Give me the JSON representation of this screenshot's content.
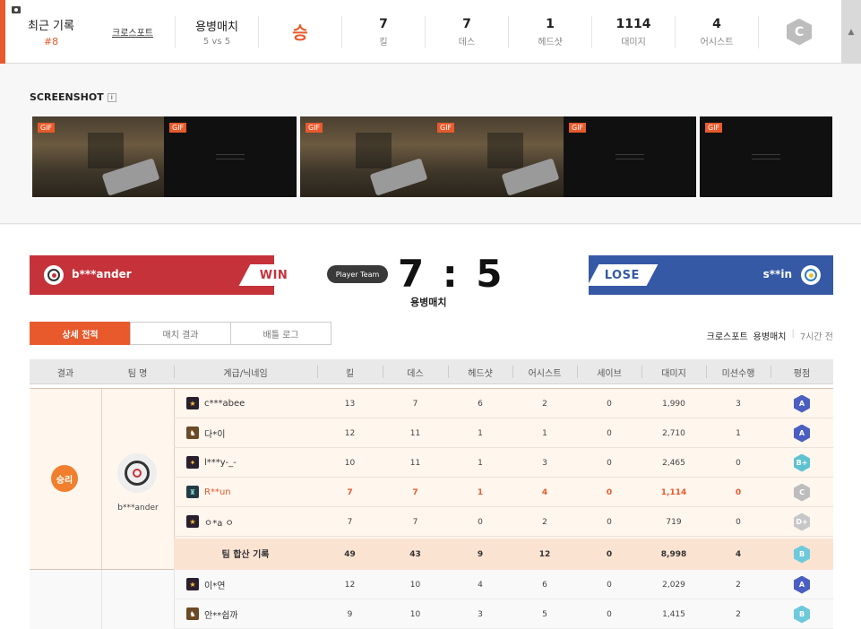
{
  "summary": {
    "title": "최근 기록",
    "record_no": "#8",
    "channel": "크로스포트",
    "mode": "용병매치",
    "mode_sub": "5 vs 5",
    "result": "승",
    "stats": [
      {
        "value": "7",
        "label": "킬"
      },
      {
        "value": "7",
        "label": "데스"
      },
      {
        "value": "1",
        "label": "헤드샷"
      },
      {
        "value": "1114",
        "label": "대미지"
      },
      {
        "value": "4",
        "label": "어시스트"
      }
    ],
    "grade": "C",
    "scroll_up": "▲"
  },
  "screenshot": {
    "title": "SCREENSHOT",
    "info": "i",
    "gif_label": "GIF",
    "thumbs": [
      "game",
      "black",
      "game",
      "game",
      "black",
      "black"
    ]
  },
  "match": {
    "left_team": "b***ander",
    "left_result": "WIN",
    "right_team": "s**in",
    "right_result": "LOSE",
    "player_team_badge": "Player Team",
    "score": "7 : 5",
    "mode": "용병매치"
  },
  "tabs": [
    "상세 전적",
    "매치 결과",
    "배틀 로그"
  ],
  "meta": {
    "map": "크로스포트",
    "mode": "용병매치",
    "separator": "|",
    "time": "7시간 전"
  },
  "table": {
    "headers": [
      "결과",
      "팀 명",
      "계급/닉네임",
      "킬",
      "데스",
      "헤드샷",
      "어시스트",
      "세이브",
      "대미지",
      "미션수행",
      "평점"
    ],
    "win_group": {
      "result": "승리",
      "team": "b***ander",
      "rows": [
        {
          "nick": "c***abee",
          "kill": "13",
          "death": "7",
          "hs": "6",
          "assist": "2",
          "save": "0",
          "damage": "1,990",
          "mission": "3",
          "grade": "A"
        },
        {
          "nick": "다*이",
          "kill": "12",
          "death": "11",
          "hs": "1",
          "assist": "1",
          "save": "0",
          "damage": "2,710",
          "mission": "1",
          "grade": "A"
        },
        {
          "nick": "l***y-_-",
          "kill": "10",
          "death": "11",
          "hs": "1",
          "assist": "3",
          "save": "0",
          "damage": "2,465",
          "mission": "0",
          "grade": "B+"
        },
        {
          "nick": "R**un",
          "kill": "7",
          "death": "7",
          "hs": "1",
          "assist": "4",
          "save": "0",
          "damage": "1,114",
          "mission": "0",
          "grade": "C"
        },
        {
          "nick": "ㅇ*a ㅇ",
          "kill": "7",
          "death": "7",
          "hs": "0",
          "assist": "2",
          "save": "0",
          "damage": "719",
          "mission": "0",
          "grade": "D+"
        }
      ],
      "total": {
        "label": "팀 합산 기록",
        "kill": "49",
        "death": "43",
        "hs": "9",
        "assist": "12",
        "save": "0",
        "damage": "8,998",
        "mission": "4",
        "grade": "B"
      }
    },
    "lose_group": {
      "rows": [
        {
          "nick": "이*연",
          "kill": "12",
          "death": "10",
          "hs": "4",
          "assist": "6",
          "save": "0",
          "damage": "2,029",
          "mission": "2",
          "grade": "A"
        },
        {
          "nick": "안**쉽까",
          "kill": "9",
          "death": "10",
          "hs": "3",
          "assist": "5",
          "save": "0",
          "damage": "1,415",
          "mission": "2",
          "grade": "B"
        }
      ]
    }
  },
  "colors": {
    "accent": "#e85a2c",
    "win_red": "#c6323a",
    "lose_blue": "#3559a5",
    "grade_a": "#4a5fc1",
    "grade_b": "#6ecadb",
    "grade_c": "#bdbdbd"
  }
}
